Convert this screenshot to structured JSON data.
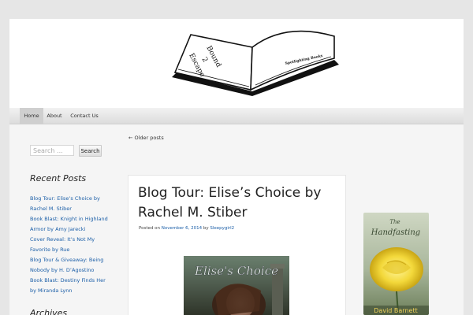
{
  "nav": {
    "items": [
      {
        "label": "Home"
      },
      {
        "label": "About"
      },
      {
        "label": "Contact Us"
      }
    ]
  },
  "logo": {
    "book_title_lines": [
      "Bound",
      "2",
      "Escape"
    ],
    "book_subtitle": "Spotlighting Books"
  },
  "sidebar": {
    "search_placeholder": "Search ...",
    "search_button": "Search",
    "recent_title": "Recent Posts",
    "recent_posts": [
      {
        "lines": [
          "Blog Tour: Elise’s Choice by",
          "Rachel M. Stiber"
        ]
      },
      {
        "lines": [
          "Book Blast: Knight in Highland",
          "Armor by Amy Jarecki"
        ]
      },
      {
        "lines": [
          "Cover Reveal: It’s Not My",
          "Favorite by Rue"
        ]
      },
      {
        "lines": [
          "Blog Tour & Giveaway: Being",
          "Nobody by H. D’Agostino"
        ]
      },
      {
        "lines": [
          "Book Blast: Destiny Finds Her",
          "by Miranda Lynn"
        ]
      }
    ],
    "next_widget_title": "Archives"
  },
  "content": {
    "older_posts": "← Older posts",
    "post": {
      "title": "Blog Tour: Elise’s Choice by Rachel M. Stiber",
      "meta_prefix": "Posted on",
      "meta_date": "November 6, 2014",
      "meta_by": "by",
      "meta_author": "Sleepygirl2",
      "cover_text": "Elise's Choice"
    }
  },
  "ad": {
    "title": "The Handfasting",
    "author": "David Barnett"
  },
  "colors": {
    "link": "#1c5fa8",
    "page_bg": "#e6e6e6",
    "content_bg": "#f5f5f5"
  }
}
